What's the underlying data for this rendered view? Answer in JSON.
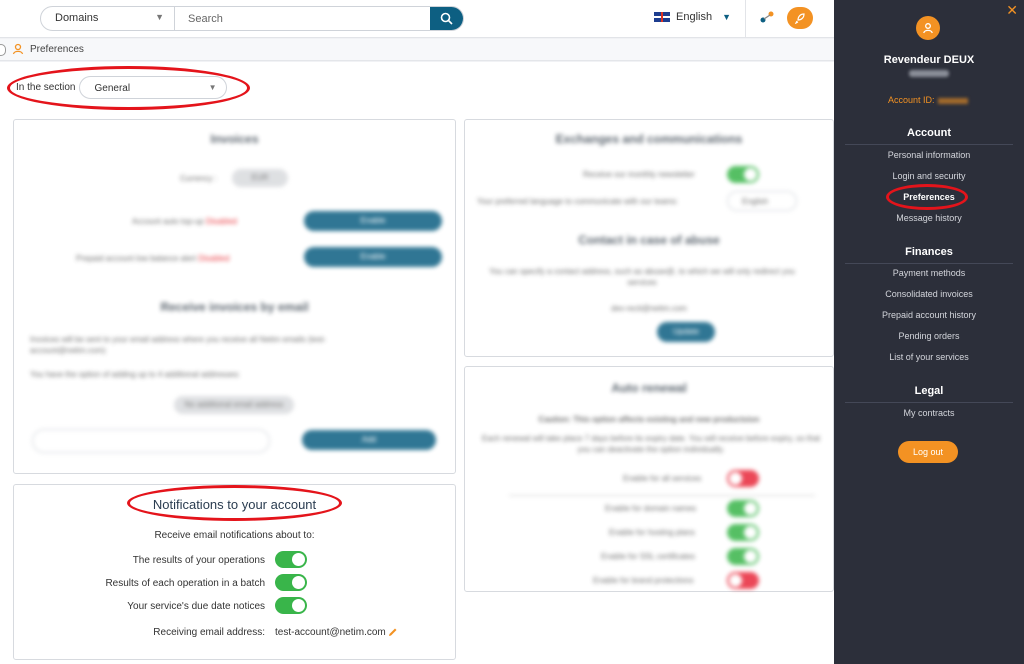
{
  "topbar": {
    "domain_select": "Domains",
    "search_placeholder": "Search",
    "language": "English"
  },
  "breadcrumb": {
    "label": "Preferences"
  },
  "section_filter": {
    "label": "In the section",
    "value": "General"
  },
  "invoices": {
    "title": "Invoices",
    "currency_label": "Currency :",
    "currency_value": "EUR",
    "auto_topup_label": "Account auto top-up",
    "auto_topup_status": "Disabled",
    "low_balance_label": "Prepaid account low balance alert",
    "low_balance_status": "Disabled",
    "enable_label": "Enable",
    "receive_title": "Receive invoices by email",
    "receive_desc": "Invoices will be sent to your email address where you receive all Netim emails (test-account@netim.com)",
    "receive_option": "You have the option of adding up to 4 additional addresses:",
    "no_additional": "No additional email address",
    "add_label": "Add"
  },
  "exchanges": {
    "title": "Exchanges and communications",
    "newsletter_label": "Receive our monthly newsletter",
    "language_label": "Your preferred language to communicate with our teams:",
    "language_value": "English",
    "abuse_title": "Contact in case of abuse",
    "abuse_desc": "You can specify a contact address, such as abuse@, to which we will only redirect you services",
    "abuse_email": "dev-recti@netim.com",
    "update_label": "Update"
  },
  "auto_renewal": {
    "title": "Auto renewal",
    "caution": "Caution: This option affects existing and new productsion",
    "desc": "Each renewal will take place 7 days before its expiry date. You will receive before expiry, so that you can deactivate the option individually.",
    "all_services": "Enable for all services",
    "items": [
      {
        "label": "Enable for domain names",
        "state": "on"
      },
      {
        "label": "Enable for hosting plans",
        "state": "on"
      },
      {
        "label": "Enable for SSL certificates",
        "state": "on"
      },
      {
        "label": "Enable for brand protections",
        "state": "off"
      }
    ]
  },
  "notifications": {
    "title": "Notifications to your account",
    "subtitle": "Receive email notifications about to:",
    "items": [
      {
        "label": "The results of your operations",
        "state": "on"
      },
      {
        "label": "Results of each operation in a batch",
        "state": "on"
      },
      {
        "label": "Your service's due date notices",
        "state": "on"
      }
    ],
    "email_label": "Receiving email address:",
    "email_value": "test-account@netim.com"
  },
  "sidebar": {
    "name": "Revendeur DEUX",
    "account_id_label": "Account ID:",
    "account_heading": "Account",
    "account_items": [
      "Personal information",
      "Login and security",
      "Preferences",
      "Message history"
    ],
    "finances_heading": "Finances",
    "finances_items": [
      "Payment methods",
      "Consolidated invoices",
      "Prepaid account history",
      "Pending orders",
      "List of your services"
    ],
    "legal_heading": "Legal",
    "legal_items": [
      "My contracts"
    ],
    "logout_label": "Log out"
  },
  "colors": {
    "accent_orange": "#f39223",
    "primary_blue": "#0d5f82",
    "toggle_on": "#39b54a",
    "toggle_off": "#e8283a",
    "highlight_red": "#e4141b",
    "sidebar_bg": "#2c2f3a"
  }
}
